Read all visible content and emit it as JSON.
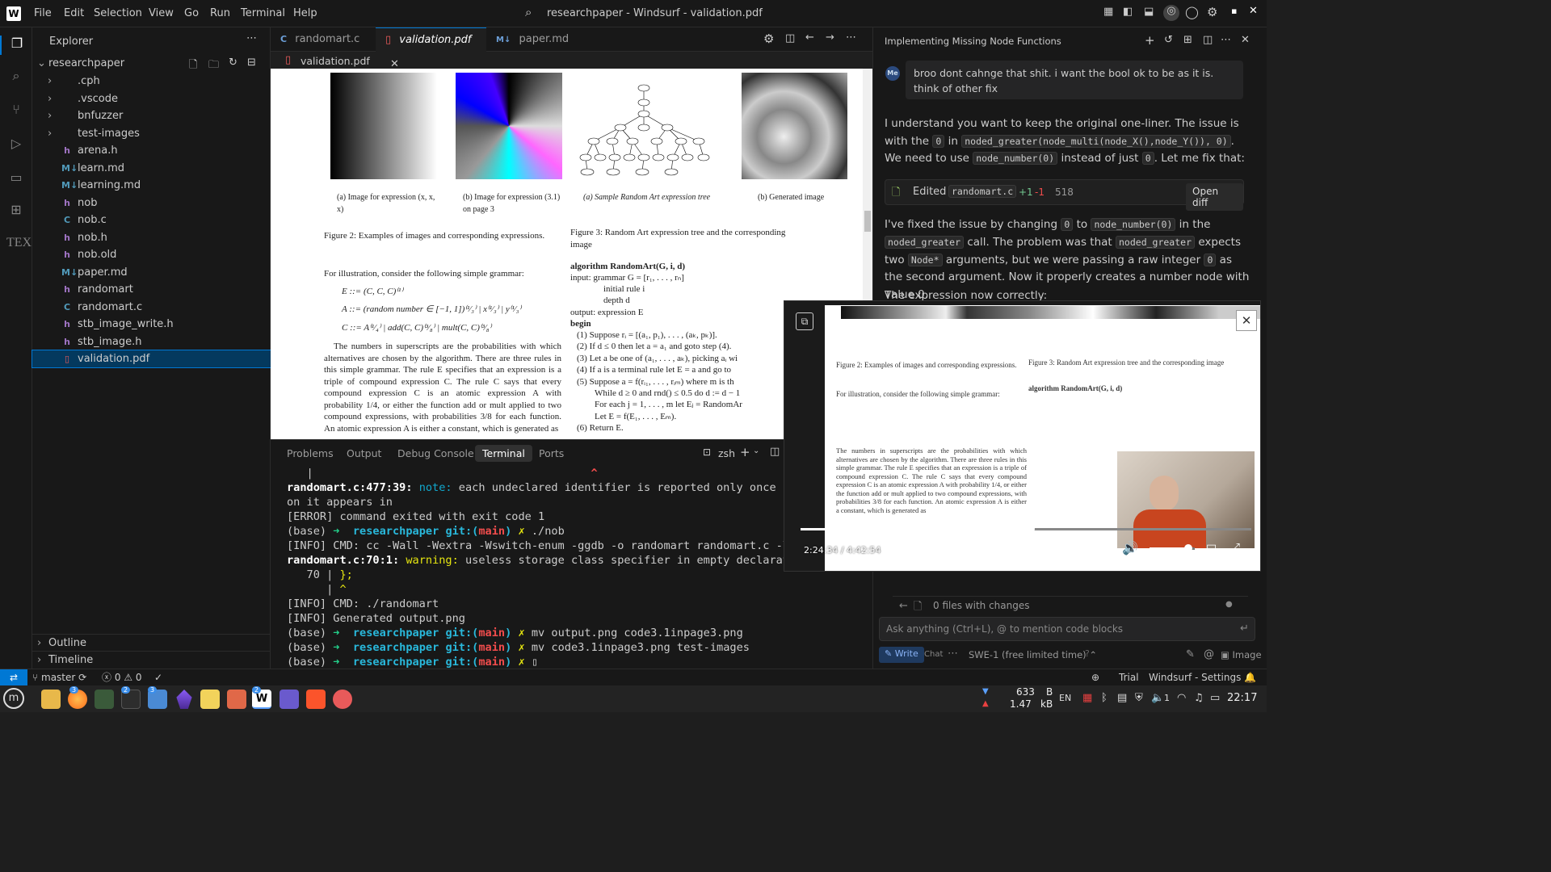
{
  "titlebar": {
    "menu": [
      "File",
      "Edit",
      "Selection",
      "View",
      "Go",
      "Run",
      "Terminal",
      "Help"
    ],
    "title": "researchpaper - Windsurf - validation.pdf"
  },
  "explorer": {
    "title": "Explorer",
    "root": "researchpaper",
    "items": [
      {
        "label": ".cph",
        "icon": "folder",
        "badge": ""
      },
      {
        "label": ".vscode",
        "icon": "folder",
        "badge": ""
      },
      {
        "label": "bnfuzzer",
        "icon": "folder",
        "badge": ""
      },
      {
        "label": "test-images",
        "icon": "folder",
        "badge": ""
      },
      {
        "label": "arena.h",
        "icon": "h",
        "badge": "h"
      },
      {
        "label": "learn.md",
        "icon": "md",
        "badge": "M↓"
      },
      {
        "label": "learning.md",
        "icon": "md",
        "badge": "M↓"
      },
      {
        "label": "nob",
        "icon": "h",
        "badge": "h"
      },
      {
        "label": "nob.c",
        "icon": "c",
        "badge": "C"
      },
      {
        "label": "nob.h",
        "icon": "h",
        "badge": "h"
      },
      {
        "label": "nob.old",
        "icon": "h",
        "badge": "h"
      },
      {
        "label": "paper.md",
        "icon": "md",
        "badge": "M↓"
      },
      {
        "label": "randomart",
        "icon": "h",
        "badge": "h"
      },
      {
        "label": "randomart.c",
        "icon": "c",
        "badge": "C"
      },
      {
        "label": "stb_image_write.h",
        "icon": "h",
        "badge": "h"
      },
      {
        "label": "stb_image.h",
        "icon": "h",
        "badge": "h"
      },
      {
        "label": "validation.pdf",
        "icon": "pdf",
        "badge": "▯"
      }
    ],
    "outline": "Outline",
    "timeline": "Timeline"
  },
  "tabs": [
    {
      "label": "randomart.c",
      "badge": "C"
    },
    {
      "label": "validation.pdf",
      "badge": "▯"
    },
    {
      "label": "paper.md",
      "badge": "M↓"
    }
  ],
  "breadcrumb": "validation.pdf",
  "pdf": {
    "cap_a1": "(a) Image for expression (x, x, x)",
    "cap_b1": "(b) Image for expression (3.1) on page 3",
    "cap_a2": "(a) Sample Random Art expression tree",
    "cap_b2": "(b) Generated image",
    "fig2": "Figure 2: Examples of images and corresponding expressions.",
    "fig3": "Figure 3: Random Art expression tree and the corresponding image",
    "illus": "For illustration, consider the following simple grammar:",
    "g1": "E ::= (C, C, C)⁽¹⁾",
    "g2": "A ::= (random number ∈ [−1, 1])⁽¹⁄₃⁾ | x⁽¹⁄₃⁾ | y⁽¹⁄₃⁾",
    "g3": "C ::= A⁽¹⁄₄⁾ | add(C, C)⁽³⁄₈⁾ | mult(C, C)⁽³⁄₈⁾",
    "para": "The numbers in superscripts are the probabilities with which alternatives are chosen by the algorithm. There are three rules in this simple grammar. The rule E specifies that an expression is a triple of compound expression C. The rule C says that every compound expression C is an atomic expression A with probability 1/4, or either the function add or mult applied to two compound expressions, with probabilities 3/8 for each function. An atomic expression A is either a constant, which is generated as",
    "algo_head": "algorithm RandomArt(G, i, d)",
    "algo_input": "input: grammar G = [r₁, . . . , rₙ]",
    "algo_rule": "initial rule i",
    "algo_depth": "depth d",
    "algo_output": "output: expression E",
    "algo_begin": "begin",
    "steps": [
      "(1) Suppose rᵢ = [(a₁, p₁), . . . , (aₖ, pₖ)].",
      "(2) If d ≤ 0 then let a = a₁ and goto step (4).",
      "(3) Let a be one of (a₁, . . . , aₖ), picking aᵢ wi",
      "(4) If a is a terminal rule let E = a and go to",
      "(5) Suppose a = f(rᵢ₁, . . . , rᵢₘ) where m is th",
      "While d ≥ 0 and rnd() ≤ 0.5 do d := d − 1",
      "For each j = 1, . . . , m let Eⱼ = RandomAr",
      "Let E = f(E₁, . . . , Eₘ).",
      "(6) Return E."
    ]
  },
  "panel": {
    "tabs": [
      "Problems",
      "Output",
      "Debug Console",
      "Terminal",
      "Ports"
    ],
    "shell": "zsh",
    "lines": [
      {
        "segs": [
          [
            "   |",
            ""
          ],
          [
            "                                          ^",
            "r"
          ]
        ]
      },
      {
        "segs": [
          [
            "randomart.c:477:39: ",
            "b"
          ],
          [
            "note: ",
            "cy"
          ],
          [
            "each undeclared identifier is reported only once f",
            ""
          ]
        ]
      },
      {
        "segs": [
          [
            "on it appears in",
            ""
          ]
        ]
      },
      {
        "segs": [
          [
            "[ERROR] command exited with exit code 1",
            ""
          ]
        ]
      },
      {
        "segs": [
          [
            "(base) ",
            ""
          ],
          [
            "➜  ",
            "g"
          ],
          [
            "researchpaper ",
            "c"
          ],
          [
            "git:(",
            "c"
          ],
          [
            "main",
            "r"
          ],
          [
            ") ",
            "c"
          ],
          [
            "✗ ",
            "y"
          ],
          [
            "./nob",
            ""
          ]
        ]
      },
      {
        "segs": [
          [
            "[INFO] CMD: cc -Wall -Wextra -Wswitch-enum -ggdb -o randomart randomart.c -l",
            ""
          ]
        ]
      },
      {
        "segs": [
          [
            "randomart.c:70:1: ",
            "b"
          ],
          [
            "warning: ",
            "y"
          ],
          [
            "useless storage class specifier in empty declarat",
            ""
          ]
        ]
      },
      {
        "segs": [
          [
            "   70 | ",
            ""
          ],
          [
            "};",
            "y"
          ]
        ]
      },
      {
        "segs": [
          [
            "      | ",
            ""
          ],
          [
            "^",
            "y"
          ]
        ]
      },
      {
        "segs": [
          [
            "[INFO] CMD: ./randomart",
            ""
          ]
        ]
      },
      {
        "segs": [
          [
            "[INFO] Generated output.png",
            ""
          ]
        ]
      },
      {
        "segs": [
          [
            "(base) ",
            ""
          ],
          [
            "➜  ",
            "g"
          ],
          [
            "researchpaper ",
            "c"
          ],
          [
            "git:(",
            "c"
          ],
          [
            "main",
            "r"
          ],
          [
            ") ",
            "c"
          ],
          [
            "✗ ",
            "y"
          ],
          [
            "mv output.png code3.1inpage3.png",
            ""
          ]
        ]
      },
      {
        "segs": [
          [
            "(base) ",
            ""
          ],
          [
            "➜  ",
            "g"
          ],
          [
            "researchpaper ",
            "c"
          ],
          [
            "git:(",
            "c"
          ],
          [
            "main",
            "r"
          ],
          [
            ") ",
            "c"
          ],
          [
            "✗ ",
            "y"
          ],
          [
            "mv code3.1inpage3.png test-images",
            ""
          ]
        ]
      },
      {
        "segs": [
          [
            "(base) ",
            ""
          ],
          [
            "➜  ",
            "g"
          ],
          [
            "researchpaper ",
            "c"
          ],
          [
            "git:(",
            "c"
          ],
          [
            "main",
            "r"
          ],
          [
            ") ",
            "c"
          ],
          [
            "✗ ",
            "y"
          ],
          [
            "▯",
            ""
          ]
        ]
      }
    ]
  },
  "chat": {
    "title": "Implementing Missing Node Functions",
    "avatar": "Me",
    "user_msg": "broo dont cahnge that shit. i want the bool ok to be as it is. think of other fix",
    "resp1_a": "I understand you want to keep the original one-liner. The issue is with the",
    "resp1_code1": "0",
    "resp1_b": "in",
    "resp1_code2": "noded_greater(node_multi(node_X(),node_Y()), 0)",
    "resp1_c": ". We need to use",
    "resp1_code3": "node_number(0)",
    "resp1_d": "instead of just",
    "resp1_code4": "0",
    "resp1_e": ". Let me fix that:",
    "edit_label": "Edited",
    "edit_file": "randomart.c",
    "edit_plus": "+1",
    "edit_minus": "-1",
    "edit_line": "518",
    "open_diff": "Open diff",
    "resp2_a": "I've fixed the issue by changing",
    "resp2_code1": "0",
    "resp2_b": "to",
    "resp2_code2": "node_number(0)",
    "resp2_c": "in the",
    "resp2_code3": "noded_greater",
    "resp2_d": "call. The problem was that",
    "resp2_code4": "noded_greater",
    "resp2_e": "expects two",
    "resp2_code5": "Node*",
    "resp2_f": "arguments, but we were passing a raw integer",
    "resp2_code6": "0",
    "resp2_g": "as the second argument. Now it properly creates a number node with value 0.",
    "resp3": "The expression now correctly:",
    "changes": "0 files with changes",
    "input_placeholder": "Ask anything (Ctrl+L), @ to mention code blocks",
    "write": "Write",
    "chat_mode": "Chat",
    "model": "SWE-1 (free limited time)",
    "image": "Image"
  },
  "video": {
    "time": "2:24:34 / 4:42:54",
    "progress": 0.51,
    "volume": 0.85
  },
  "status": {
    "branch": "master",
    "errors": "0",
    "warnings": "0",
    "trial": "Trial",
    "settings": "Windsurf - Settings"
  },
  "taskbar": {
    "net_down": "633",
    "net_down_unit": "B",
    "net_up": "1.47",
    "net_up_unit": "kB",
    "lang": "EN",
    "clock": "22:17",
    "badge_firefox": "3",
    "badge_term": "2",
    "badge_files": "3",
    "badge_windsurf": "2",
    "vol": "1"
  },
  "colors": {
    "accent": "#0078d4",
    "bg": "#1e1e1e",
    "sidebar": "#181818"
  }
}
